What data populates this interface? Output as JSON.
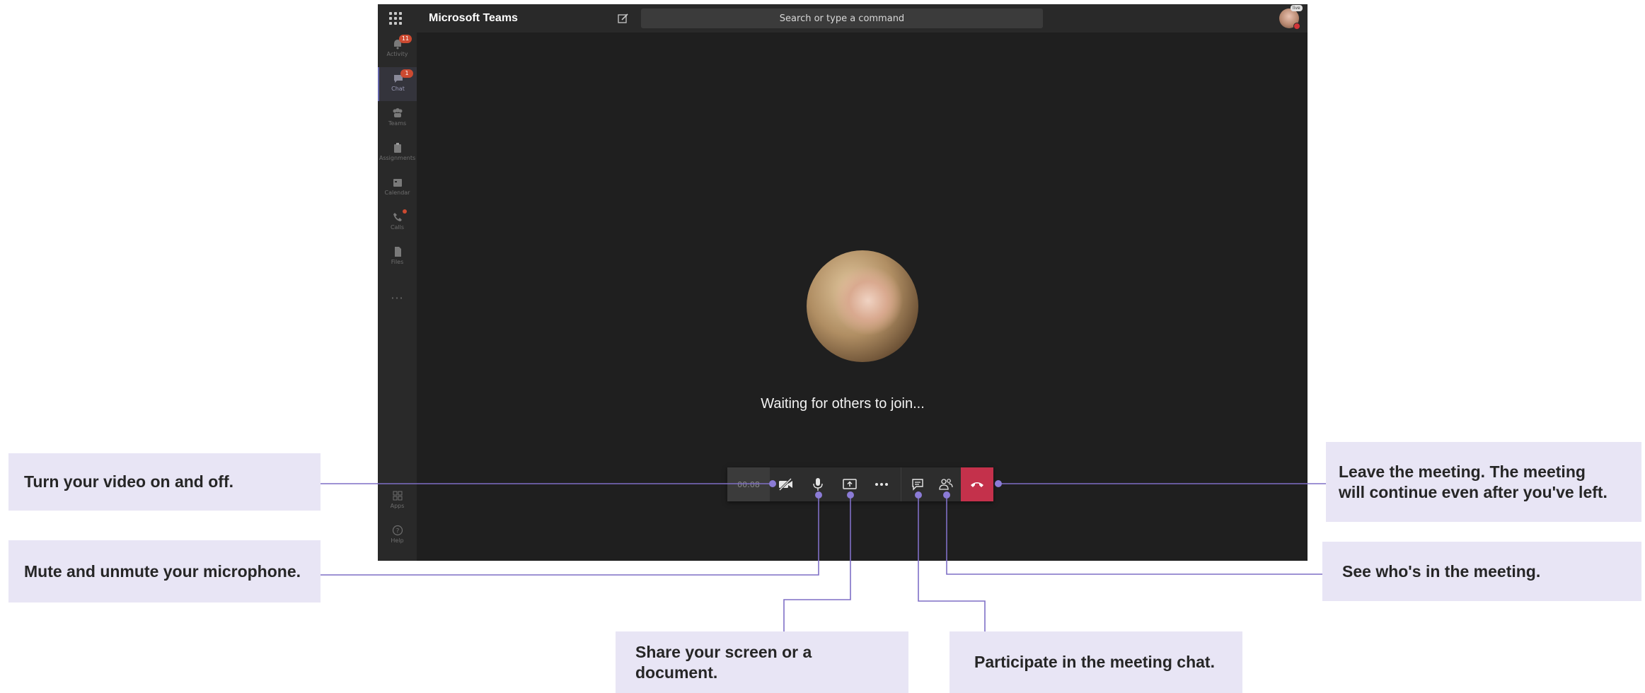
{
  "window": {
    "app_title": "Microsoft Teams",
    "search_placeholder": "Search or type a command",
    "status_pill": "live"
  },
  "rail": {
    "items": [
      {
        "label": "Activity",
        "badge": "11"
      },
      {
        "label": "Chat",
        "badge": "1"
      },
      {
        "label": "Teams",
        "badge": ""
      },
      {
        "label": "Assignments",
        "badge": ""
      },
      {
        "label": "Calendar",
        "badge": ""
      },
      {
        "label": "Calls",
        "badge": ""
      },
      {
        "label": "Files",
        "badge": ""
      }
    ],
    "more_label": "···",
    "apps_label": "Apps",
    "help_label": "Help"
  },
  "stage": {
    "waiting_text": "Waiting for others to join..."
  },
  "call_bar": {
    "timer": "00:08"
  },
  "callouts": {
    "video": "Turn your video on and off.",
    "mic": "Mute and unmute your microphone.",
    "share": "Share your screen or a document.",
    "chat": "Participate in the meeting chat.",
    "leave_line1": "Leave the meeting. The meeting",
    "leave_line2": "will continue even after you've left.",
    "participants": "See who's in the meeting."
  },
  "colors": {
    "accent": "#6264a7",
    "connector": "#7f6fc6",
    "hangup": "#c4314b",
    "callout_bg": "#e8e5f5"
  }
}
